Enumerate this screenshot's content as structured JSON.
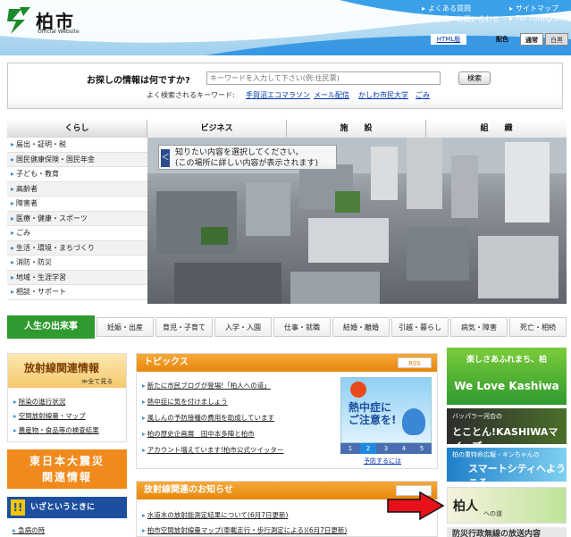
{
  "header": {
    "logo_title": "柏市",
    "logo_sub": "Official Website",
    "top_links": [
      "よくある質問",
      "サイトマップ",
      "ご意見・お問い合わせ",
      "For Foreigners"
    ],
    "html_btn": "HTML版",
    "color_label": "配色",
    "color_normal": "通常",
    "color_black": "白黒"
  },
  "search": {
    "title": "お探しの情報は何ですか?",
    "placeholder": "キーワードを入力して下さい(例:住民票)",
    "button": "検索",
    "kw_label": "よく検索されるキーワード:",
    "keywords": [
      "手賀沼エコマラソン",
      "メール配信",
      "かしわ市民大学",
      "ごみ"
    ]
  },
  "nav": {
    "tabs": [
      "くらし",
      "ビジネス",
      "施　　設",
      "組　　織"
    ]
  },
  "side": {
    "items": [
      "届出・証明・税",
      "国民健康保険・国民年金",
      "子ども・教育",
      "高齢者",
      "障害者",
      "医療・健康・スポーツ",
      "ごみ",
      "生活・環境・まちづくり",
      "消防・防災",
      "地域・生涯学習",
      "相談・サポート"
    ]
  },
  "photo": {
    "note_line1": "知りたい内容を選択してください。",
    "note_line2": "(この場所に詳しい内容が表示されます)",
    "arrow": "＜"
  },
  "life": {
    "label": "人生の出来事",
    "items": [
      "妊娠・出産",
      "育児・子育て",
      "入学・入園",
      "仕事・就職",
      "結婚・離婚",
      "引越・暮らし",
      "病気・障害",
      "死亡・相続"
    ]
  },
  "radiation": {
    "title": "放射線関連情報",
    "more": "≫全て見る",
    "links": [
      "除染の進行状況",
      "空間放射線量・マップ",
      "農産物・食品等の検査結果"
    ]
  },
  "quake": {
    "line1": "東日本大震災",
    "line2": "関連情報"
  },
  "emergency": {
    "icon": "!!",
    "title": "いざというときに",
    "link": "急病の時"
  },
  "topics": {
    "title": "トピックス",
    "rss": "RSS",
    "items": [
      "新たに市民ブログが登場!「柏人への道」",
      "熱中症に気を付けましょう",
      "風しんの予防接種の費用を助成しています",
      "柏の歴史企画展　田中本多陣と柏市",
      "アカウント増えています!柏市公式ツイッター"
    ],
    "heat_line1": "熱中症に",
    "heat_line2": "ご注意を!",
    "pages": [
      "1",
      "2",
      "3",
      "4",
      "5"
    ],
    "yobou": "予防するには"
  },
  "radnews": {
    "title": "放射線関連のお知らせ",
    "items": [
      "水道水の放射能測定結果について(6月7日更新)",
      "柏市空間放射線量マップ(車載走行・歩行測定による)(6月7日更新)"
    ]
  },
  "banners": {
    "b1_top": "楽しさあふれまち、柏",
    "b1_main": "We Love Kashiwa",
    "b2_top": "バッパラー河合の",
    "b2_main": "とことん!KASHIWAマイップ",
    "b3_top": "柏の重特命広報・キンちゃんの",
    "b3_main": "スマートシティへようこそ",
    "b4_text": "柏人",
    "b4_sub": "への道",
    "b5_text": "防災行政無線の放送内容"
  },
  "colors": {
    "life_green": "#2f9a2f",
    "topics_orange": "#e8860c",
    "emergency_blue": "#1d4f9e",
    "arrow_red": "#e8101a"
  }
}
